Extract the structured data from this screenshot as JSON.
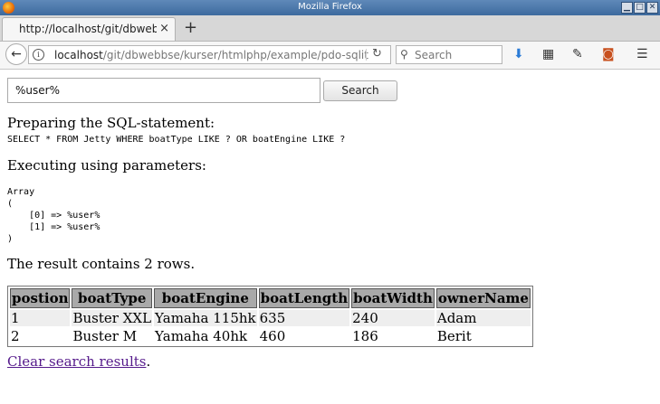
{
  "window": {
    "title": "Mozilla Firefox"
  },
  "tab": {
    "title": "http://localhost/git/dbwebbse/kurser/htmlphp/example/pdo-sqlit",
    "close": "×",
    "new_tab": "+"
  },
  "navbar": {
    "url_host": "localhost",
    "url_path": "/git/dbwebbse/kurser/htmlphp/example/pdo-sqlit",
    "search_placeholder": "Search"
  },
  "form": {
    "query_value": "%user%",
    "search_button": "Search"
  },
  "sections": {
    "preparing_heading": "Preparing the SQL-statement:",
    "sql": "SELECT * FROM Jetty WHERE boatType LIKE ? OR boatEngine LIKE ?",
    "executing_heading": "Executing using parameters:",
    "params_dump": "Array\n(\n    [0] => %user%\n    [1] => %user%\n)",
    "result_text": "The result contains 2 rows."
  },
  "table": {
    "headers": [
      "postion",
      "boatType",
      "boatEngine",
      "boatLength",
      "boatWidth",
      "ownerName"
    ],
    "rows": [
      [
        "1",
        "Buster XXL",
        "Yamaha 115hk",
        "635",
        "240",
        "Adam"
      ],
      [
        "2",
        "Buster M",
        "Yamaha 40hk",
        "460",
        "186",
        "Berit"
      ]
    ]
  },
  "clear_link": {
    "label": "Clear search results",
    "suffix": "."
  }
}
